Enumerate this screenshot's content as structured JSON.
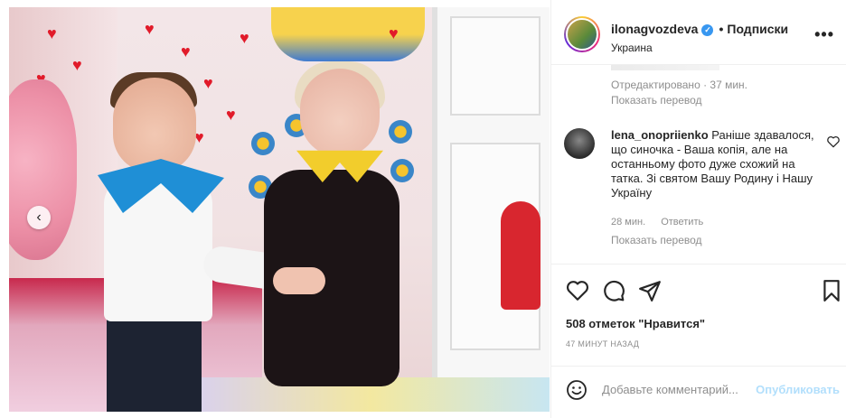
{
  "header": {
    "username": "ilonagvozdeva",
    "follow_label": "Подписки",
    "location": "Украина"
  },
  "caption": {
    "edited_label": "Отредактировано · 37 мин.",
    "translate_label": "Показать перевод"
  },
  "comment": {
    "username": "lena_onopriienko",
    "text": "Раніше здавалося, що синочка - Ваша копія, але на останньому фото дуже схожий на татка. Зі святом Вашу Родину і Нашу Україну",
    "time": "28 мин.",
    "reply_label": "Ответить",
    "translate_label": "Показать перевод"
  },
  "actions": {
    "likes_label": "508 отметок \"Нравится\"",
    "time_ago": "47 МИНУТ НАЗАД"
  },
  "add_comment": {
    "placeholder": "Добавьте комментарий...",
    "publish_label": "Опубликовать"
  },
  "carousel": {
    "prev_symbol": "‹"
  },
  "colors": {
    "link_blue_disabled": "#b2dffc",
    "verified_blue": "#3897f0",
    "secondary_text": "#8e8e8e",
    "primary_text": "#262626"
  }
}
